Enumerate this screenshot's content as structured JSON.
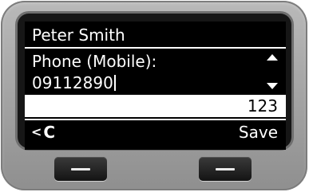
{
  "contact": {
    "name": "Peter Smith"
  },
  "field": {
    "label": "Phone (Mobile):",
    "value": "09112890"
  },
  "input_mode": "123",
  "softkeys": {
    "left": "C",
    "left_icon": "arrow-left-icon",
    "right": "Save"
  },
  "hardware_keys": [
    "left-display-key",
    "right-display-key"
  ],
  "colors": {
    "screen_bg": "#000000",
    "screen_fg": "#ffffff",
    "mode_bar_bg": "#ffffff",
    "device_body": "#a6a6a6"
  }
}
